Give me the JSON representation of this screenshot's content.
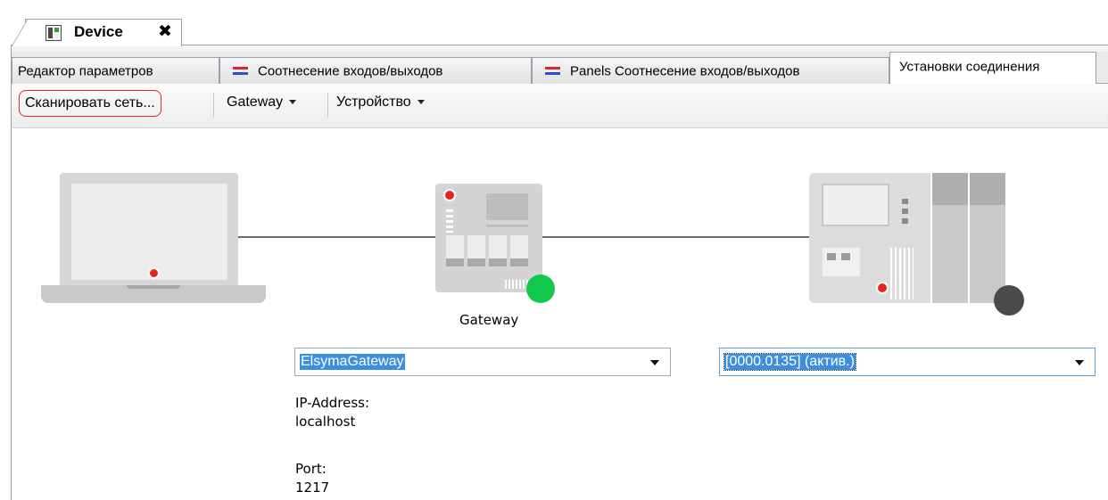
{
  "document_tab": {
    "label": "Device",
    "close_glyph": "✖",
    "icon": "device-icon"
  },
  "editor_tabs": [
    {
      "label": "Редактор параметров",
      "icon": ""
    },
    {
      "label": "Соотнесение входов/выходов",
      "icon": "io-mapping-icon"
    },
    {
      "label": "Panels Соотнесение входов/выходов",
      "icon": "io-mapping-icon"
    },
    {
      "label": "Установки соединения",
      "icon": "",
      "active": true
    }
  ],
  "toolbar": {
    "scan_label": "Сканировать сеть...",
    "gateway_label": "Gateway",
    "device_label": "Устройство"
  },
  "topology": {
    "gateway_caption": "Gateway",
    "gateway_status_color": "#11c94b",
    "device_status_color": "#4a4a4a",
    "led_color": "#e5231f"
  },
  "gateway_select": {
    "value": "ElsymaGateway"
  },
  "device_select": {
    "value": "[0000.0135] (актив.)"
  },
  "gateway_info": {
    "ip_label": "IP-Address:",
    "ip_value": "localhost",
    "port_label": "Port:",
    "port_value": "1217"
  }
}
